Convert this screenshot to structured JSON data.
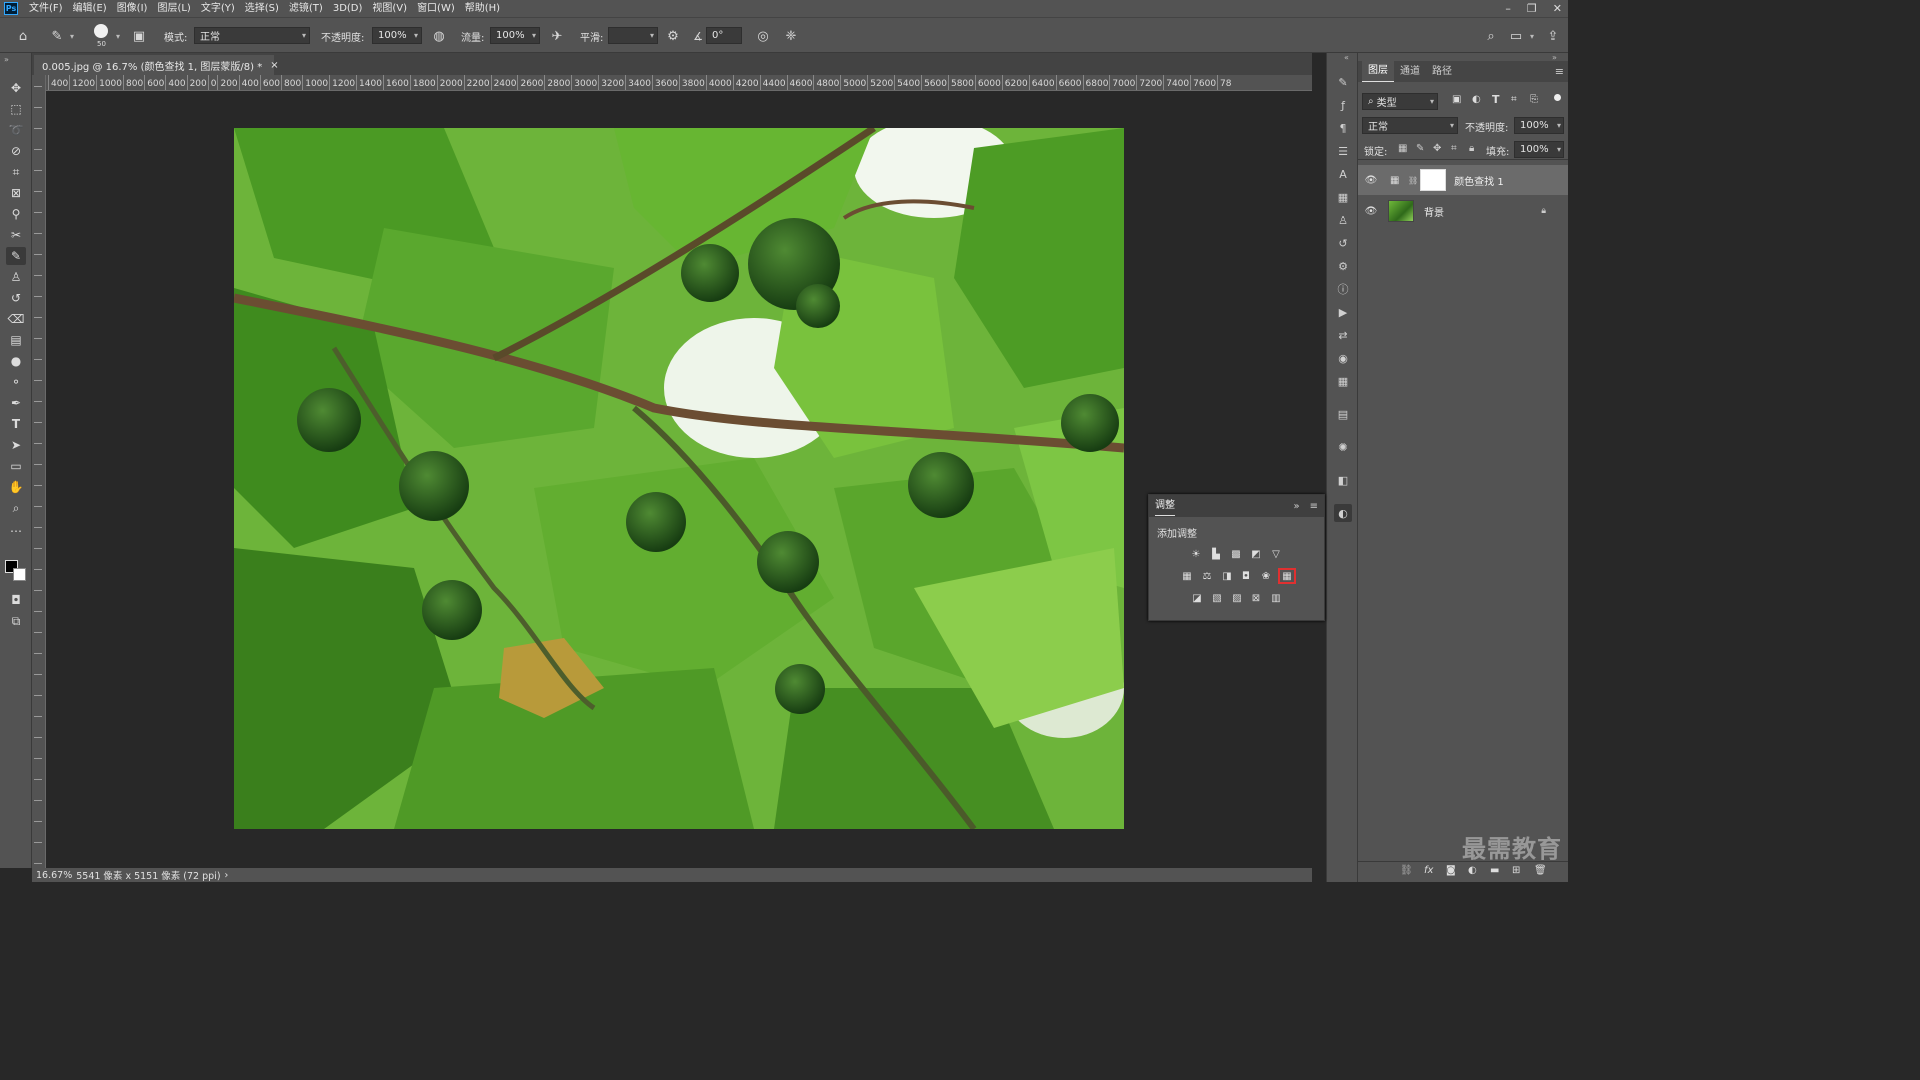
{
  "app": {
    "logo": "Ps"
  },
  "menu": [
    "文件(F)",
    "编辑(E)",
    "图像(I)",
    "图层(L)",
    "文字(Y)",
    "选择(S)",
    "滤镜(T)",
    "3D(D)",
    "视图(V)",
    "窗口(W)",
    "帮助(H)"
  ],
  "window_controls": {
    "minimize": "–",
    "restore": "❐",
    "close": "✕"
  },
  "options": {
    "brush_size": "50",
    "mode_label": "模式:",
    "mode_value": "正常",
    "opacity_label": "不透明度:",
    "opacity_value": "100%",
    "flow_label": "流量:",
    "flow_value": "100%",
    "smoothing_label": "平滑:",
    "smoothing_value": "",
    "angle_value": "0°"
  },
  "document": {
    "tab_title": "0.005.jpg @ 16.7% (颜色查找 1, 图层蒙版/8) *",
    "close": "×"
  },
  "hruler": [
    "400",
    "1200",
    "1000",
    "800",
    "600",
    "400",
    "200",
    "0",
    "200",
    "400",
    "600",
    "800",
    "1000",
    "1200",
    "1400",
    "1600",
    "1800",
    "2000",
    "2200",
    "2400",
    "2600",
    "2800",
    "3000",
    "3200",
    "3400",
    "3600",
    "3800",
    "4000",
    "4200",
    "4400",
    "4600",
    "4800",
    "5000",
    "5200",
    "5400",
    "5600",
    "5800",
    "6000",
    "6200",
    "6400",
    "6600",
    "6800",
    "7000",
    "7200",
    "7400",
    "7600",
    "78"
  ],
  "status": {
    "zoom": "16.67%",
    "info": "5541 像素 x 5151 像素 (72 ppi)",
    "arrow": "›"
  },
  "layers_panel": {
    "tabs": [
      "图层",
      "通道",
      "路径"
    ],
    "filter_kind": "类型",
    "blend_mode": "正常",
    "opacity_label": "不透明度:",
    "opacity_value": "100%",
    "lock_label": "锁定:",
    "fill_label": "填充:",
    "fill_value": "100%",
    "layers": [
      {
        "name": "颜色查找 1",
        "selected": true
      },
      {
        "name": "背景",
        "selected": false
      }
    ]
  },
  "adjustments": {
    "title": "调整",
    "subtitle": "添加调整",
    "collapse": "»",
    "menu": "≡"
  },
  "watermark": "最需教育",
  "colors": {
    "ui_bg": "#535353",
    "canvas_bg": "#282828",
    "highlight": "#e03030",
    "selected_layer": "#6b6b6b"
  }
}
